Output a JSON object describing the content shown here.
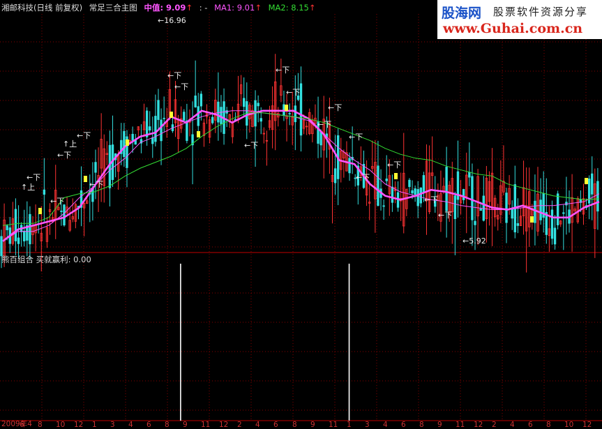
{
  "header": {
    "stock": "湘邮科技(日线 前复权)",
    "indicator": "常足三合主图",
    "mid_label": "中值: 9.09",
    "mid_arrow": "↑",
    "sep": ": -",
    "ma1_label": "MA1: 9.01",
    "ma1_arrow": "↑",
    "ma2_label": "MA2: 8.15",
    "ma2_arrow": "↑"
  },
  "sub_header": "熊百组合  买就赢利: 0.00",
  "logo": {
    "name": "股海网",
    "slogan": "股票软件资源分享",
    "url": "www.Guhai.com.cn"
  },
  "colors": {
    "mid": "#ff55ff",
    "ma1": "#ff55ff",
    "ma2": "#33dd33",
    "up": "#ff3333",
    "down": "#33e0e0",
    "grid": "#8a0000",
    "axis": "#c00000"
  },
  "chart_data": [
    {
      "type": "candlestick",
      "title": "湘邮科技(日线 前复权)",
      "annotations": {
        "high": "16.96",
        "low": "5.92",
        "signal": "下",
        "signal_up": "上"
      },
      "ylim": [
        5.5,
        17.5
      ],
      "series": [
        {
          "name": "中值",
          "values": [
            6.0,
            6.6,
            6.8,
            7.0,
            7.2,
            7.7,
            8.8,
            9.9,
            10.8,
            11.3,
            11.5,
            12.3,
            12.0,
            12.6,
            12.4,
            12.0,
            12.4,
            12.6,
            12.6,
            12.6,
            12.2,
            11.4,
            10.1,
            9.9,
            8.9,
            8.3,
            8.1,
            8.3,
            8.6,
            8.5,
            8.3,
            8.0,
            7.7,
            7.6,
            7.8,
            7.5,
            7.2,
            7.2,
            7.7,
            8.0
          ]
        },
        {
          "name": "MA1",
          "values": [
            6.0,
            6.5,
            6.5,
            6.8,
            7.4,
            8.2,
            8.8,
            9.6,
            10.2,
            11.0,
            11.3,
            11.7,
            12.0,
            12.3,
            12.5,
            12.6,
            12.6,
            12.5,
            12.4,
            12.3,
            12.1,
            11.4,
            10.7,
            10.1,
            9.6,
            8.9,
            8.5,
            8.3,
            8.1,
            8.0,
            7.8,
            7.7,
            7.6,
            7.6,
            7.7,
            7.8,
            7.8,
            7.9,
            8.0,
            8.4
          ]
        },
        {
          "name": "MA2",
          "values": [
            6.8,
            6.9,
            6.9,
            7.2,
            8.2,
            8.4,
            8.5,
            8.8,
            9.3,
            9.7,
            10.0,
            10.3,
            10.7,
            11.3,
            11.8,
            12.2,
            12.5,
            12.5,
            12.4,
            12.3,
            12.2,
            12.0,
            11.7,
            11.4,
            11.1,
            10.7,
            10.4,
            10.2,
            10.1,
            9.8,
            9.6,
            9.4,
            9.3,
            8.9,
            8.7,
            8.5,
            8.3,
            8.2,
            8.1,
            8.15
          ]
        }
      ]
    },
    {
      "type": "bar",
      "title": "熊百组合",
      "series": [
        {
          "name": "买就赢利",
          "events": [
            {
              "x_frac": 0.3,
              "value": 1.0
            },
            {
              "x_frac": 0.58,
              "value": 1.0
            }
          ]
        }
      ],
      "ylim": [
        0,
        1
      ]
    }
  ],
  "x_ticks": [
    "2009年4",
    "6",
    "8",
    "10",
    "12",
    "1",
    "3",
    "4",
    "6",
    "8",
    "9",
    "11",
    "12",
    "2",
    "4",
    "6",
    "8",
    "9",
    "11",
    "1",
    "3",
    "4",
    "6",
    "8",
    "9",
    "11",
    "12",
    "2",
    "4",
    "6",
    "8",
    "10",
    "12"
  ]
}
